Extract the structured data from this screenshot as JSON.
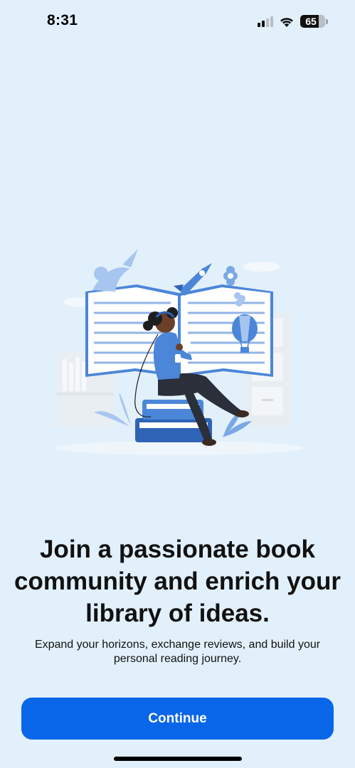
{
  "status_bar": {
    "time": "8:31",
    "battery_level": "65",
    "signal_icon": "cellular-signal-icon",
    "wifi_icon": "wifi-icon"
  },
  "onboarding": {
    "illustration": "woman-reading-on-books-illustration",
    "title": "Join a passionate book community and enrich your library of ideas.",
    "subtitle": "Expand your horizons, exchange reviews, and build your personal reading journey."
  },
  "actions": {
    "continue_label": "Continue"
  },
  "colors": {
    "background": "#e2f0fb",
    "accent": "#0a66e9",
    "illustration_blue": "#4b86d8"
  }
}
